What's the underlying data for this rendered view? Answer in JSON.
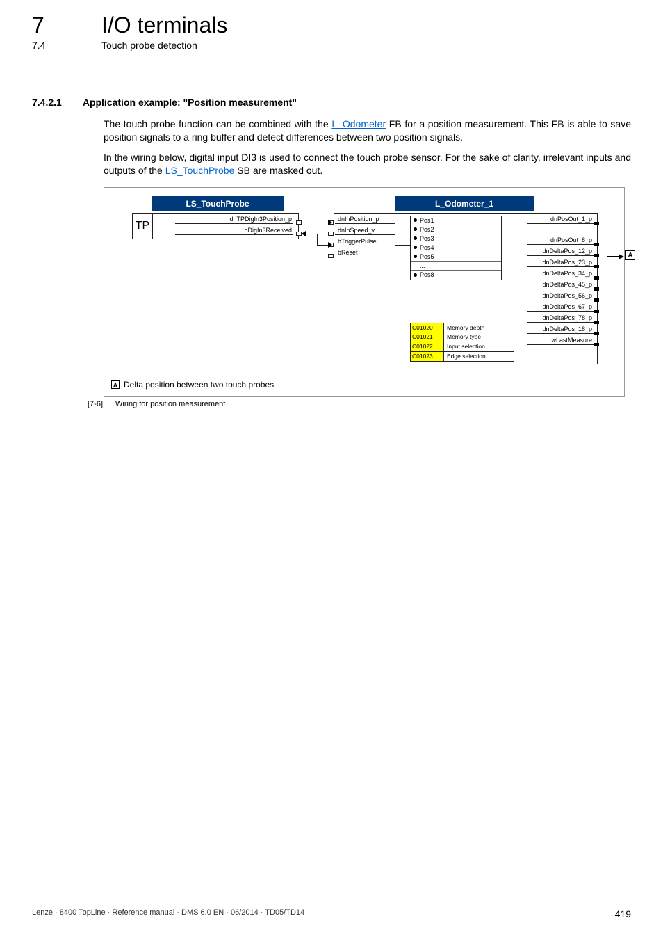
{
  "header": {
    "chapter_number": "7",
    "chapter_title": "I/O terminals",
    "section_number": "7.4",
    "section_title": "Touch probe detection"
  },
  "dashes": "_ _ _ _ _ _ _ _ _ _ _ _ _ _ _ _ _ _ _ _ _ _ _ _ _ _ _ _ _ _ _ _ _ _ _ _ _ _ _ _ _ _ _ _ _ _ _ _ _ _ _ _ _ _ _ _ _ _ _ _ _ _ _ _",
  "section_heading": {
    "number": "7.4.2.1",
    "title": "Application example: \"Position measurement\""
  },
  "para1_a": "The touch probe function can be combined with the ",
  "para1_link1": "L_Odometer",
  "para1_b": " FB for a position measurement. This FB is able to save position signals to a ring buffer and detect differences between two position signals.",
  "para2_a": "In the wiring below, digital input DI3 is used to connect the touch probe sensor. For the sake of clarity, irrelevant inputs and outputs of the ",
  "para2_link1": "LS_TouchProbe",
  "para2_b": " SB are masked out.",
  "diagram": {
    "touchprobe": {
      "title": "LS_TouchProbe",
      "badge": "TP",
      "out1": "dnTPDigIn3Position_p",
      "out2": "bDigIn3Received"
    },
    "odometer": {
      "title": "L_Odometer_1",
      "inputs": [
        "dnInPosition_p",
        "dnInSpeed_v",
        "bTriggerPulse",
        "bReset"
      ],
      "mid_rows": [
        "Pos1",
        "Pos2",
        "Pos3",
        "Pos4",
        "Pos5",
        "Pos8"
      ],
      "mid_ellipsis": "...",
      "outputs": [
        "dnPosOut_1_p",
        "...",
        "dnPosOut_8_p",
        "dnDeltaPos_12_p",
        "dnDeltaPos_23_p",
        "dnDeltaPos_34_p",
        "dnDeltaPos_45_p",
        "dnDeltaPos_56_p",
        "dnDeltaPos_67_p",
        "dnDeltaPos_78_p",
        "dnDeltaPos_18_p",
        "wLastMeasure"
      ],
      "params": [
        {
          "code": "C01020",
          "label": "Memory depth"
        },
        {
          "code": "C01021",
          "label": "Memory type"
        },
        {
          "code": "C01022",
          "label": "Input selection"
        },
        {
          "code": "C01023",
          "label": "Edge selection"
        }
      ]
    },
    "label_A": "A",
    "legend_A": "A",
    "legend_text": "Delta position between two touch probes"
  },
  "caption": {
    "num": "[7-6]",
    "text": "Wiring for position measurement"
  },
  "footer": {
    "left": "Lenze · 8400 TopLine · Reference manual · DMS 6.0 EN · 06/2014 · TD05/TD14",
    "page": "419"
  }
}
